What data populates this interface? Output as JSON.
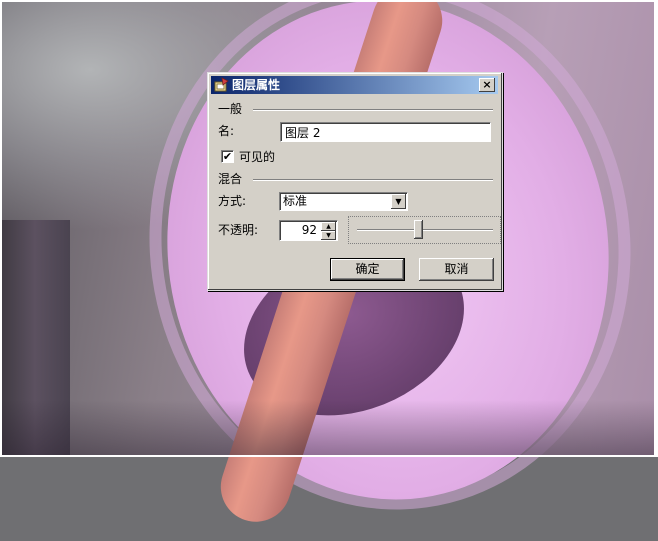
{
  "dialog": {
    "title": "图层属性",
    "close_glyph": "×",
    "general_group": "一般",
    "name_label": "名:",
    "name_value": "图层 2",
    "visible_checked": true,
    "visible_label": "可见的",
    "blend_group": "混合",
    "mode_label": "方式:",
    "mode_value": "标准",
    "opacity_label": "不透明:",
    "opacity_value": "92",
    "opacity_fraction": 0.45,
    "ok_label": "确定",
    "cancel_label": "取消"
  },
  "colors": {
    "titlebar_start": "#0a246a",
    "titlebar_end": "#a6caf0",
    "dialog_face": "#d4d0c8"
  }
}
